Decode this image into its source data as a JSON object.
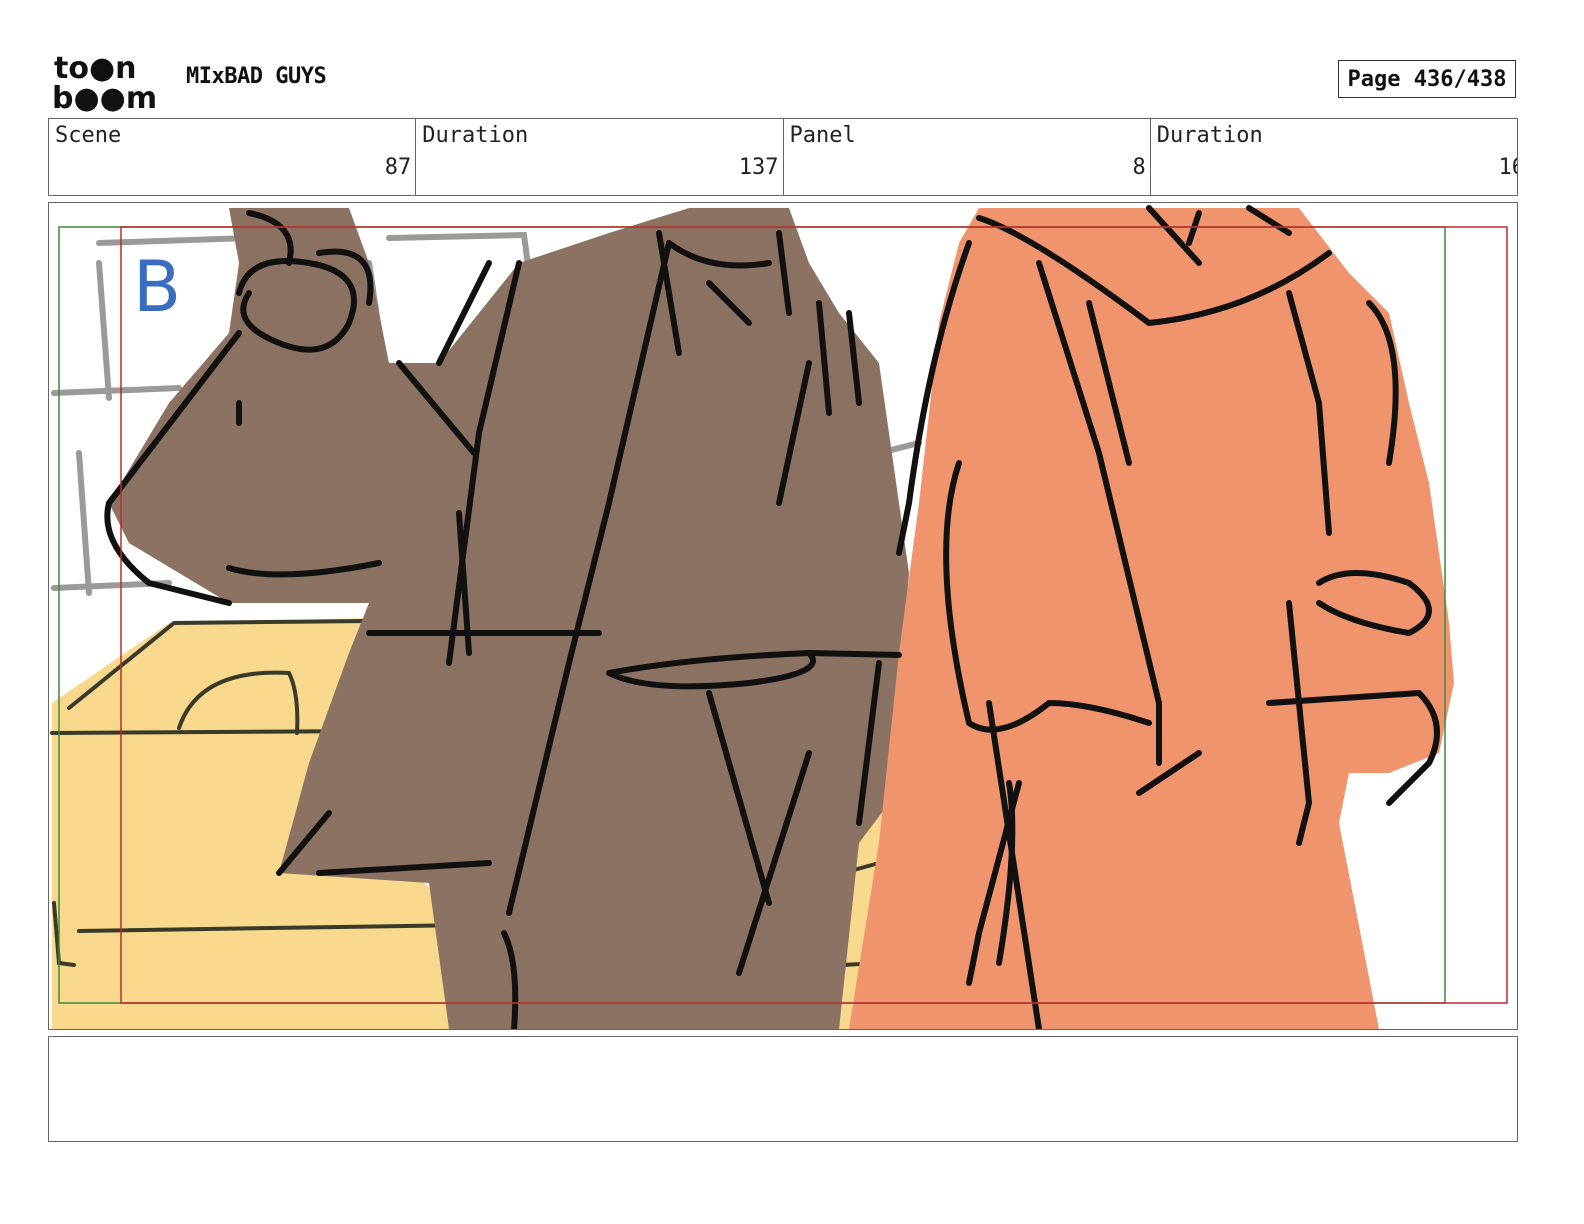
{
  "header": {
    "logo_top": "to●n",
    "logo_bottom": "b●●m",
    "project_title": "MIxBAD GUYS",
    "page_label": "Page 436/438"
  },
  "info": {
    "scene_label": "Scene",
    "scene_value": "87",
    "scene_duration_label": "Duration",
    "scene_duration_value": "137",
    "panel_label": "Panel",
    "panel_value": "8",
    "panel_duration_label": "Duration",
    "panel_duration_value": "16"
  },
  "panel": {
    "letter": "B",
    "colors": {
      "brown_robe": "#8b7262",
      "orange_robe": "#f0946e",
      "crate": "#f7d88c",
      "letter": "#3a6cc0",
      "frame_red": "#c0282a",
      "frame_green": "#3a8a3a"
    }
  },
  "notes": {
    "text": ""
  }
}
